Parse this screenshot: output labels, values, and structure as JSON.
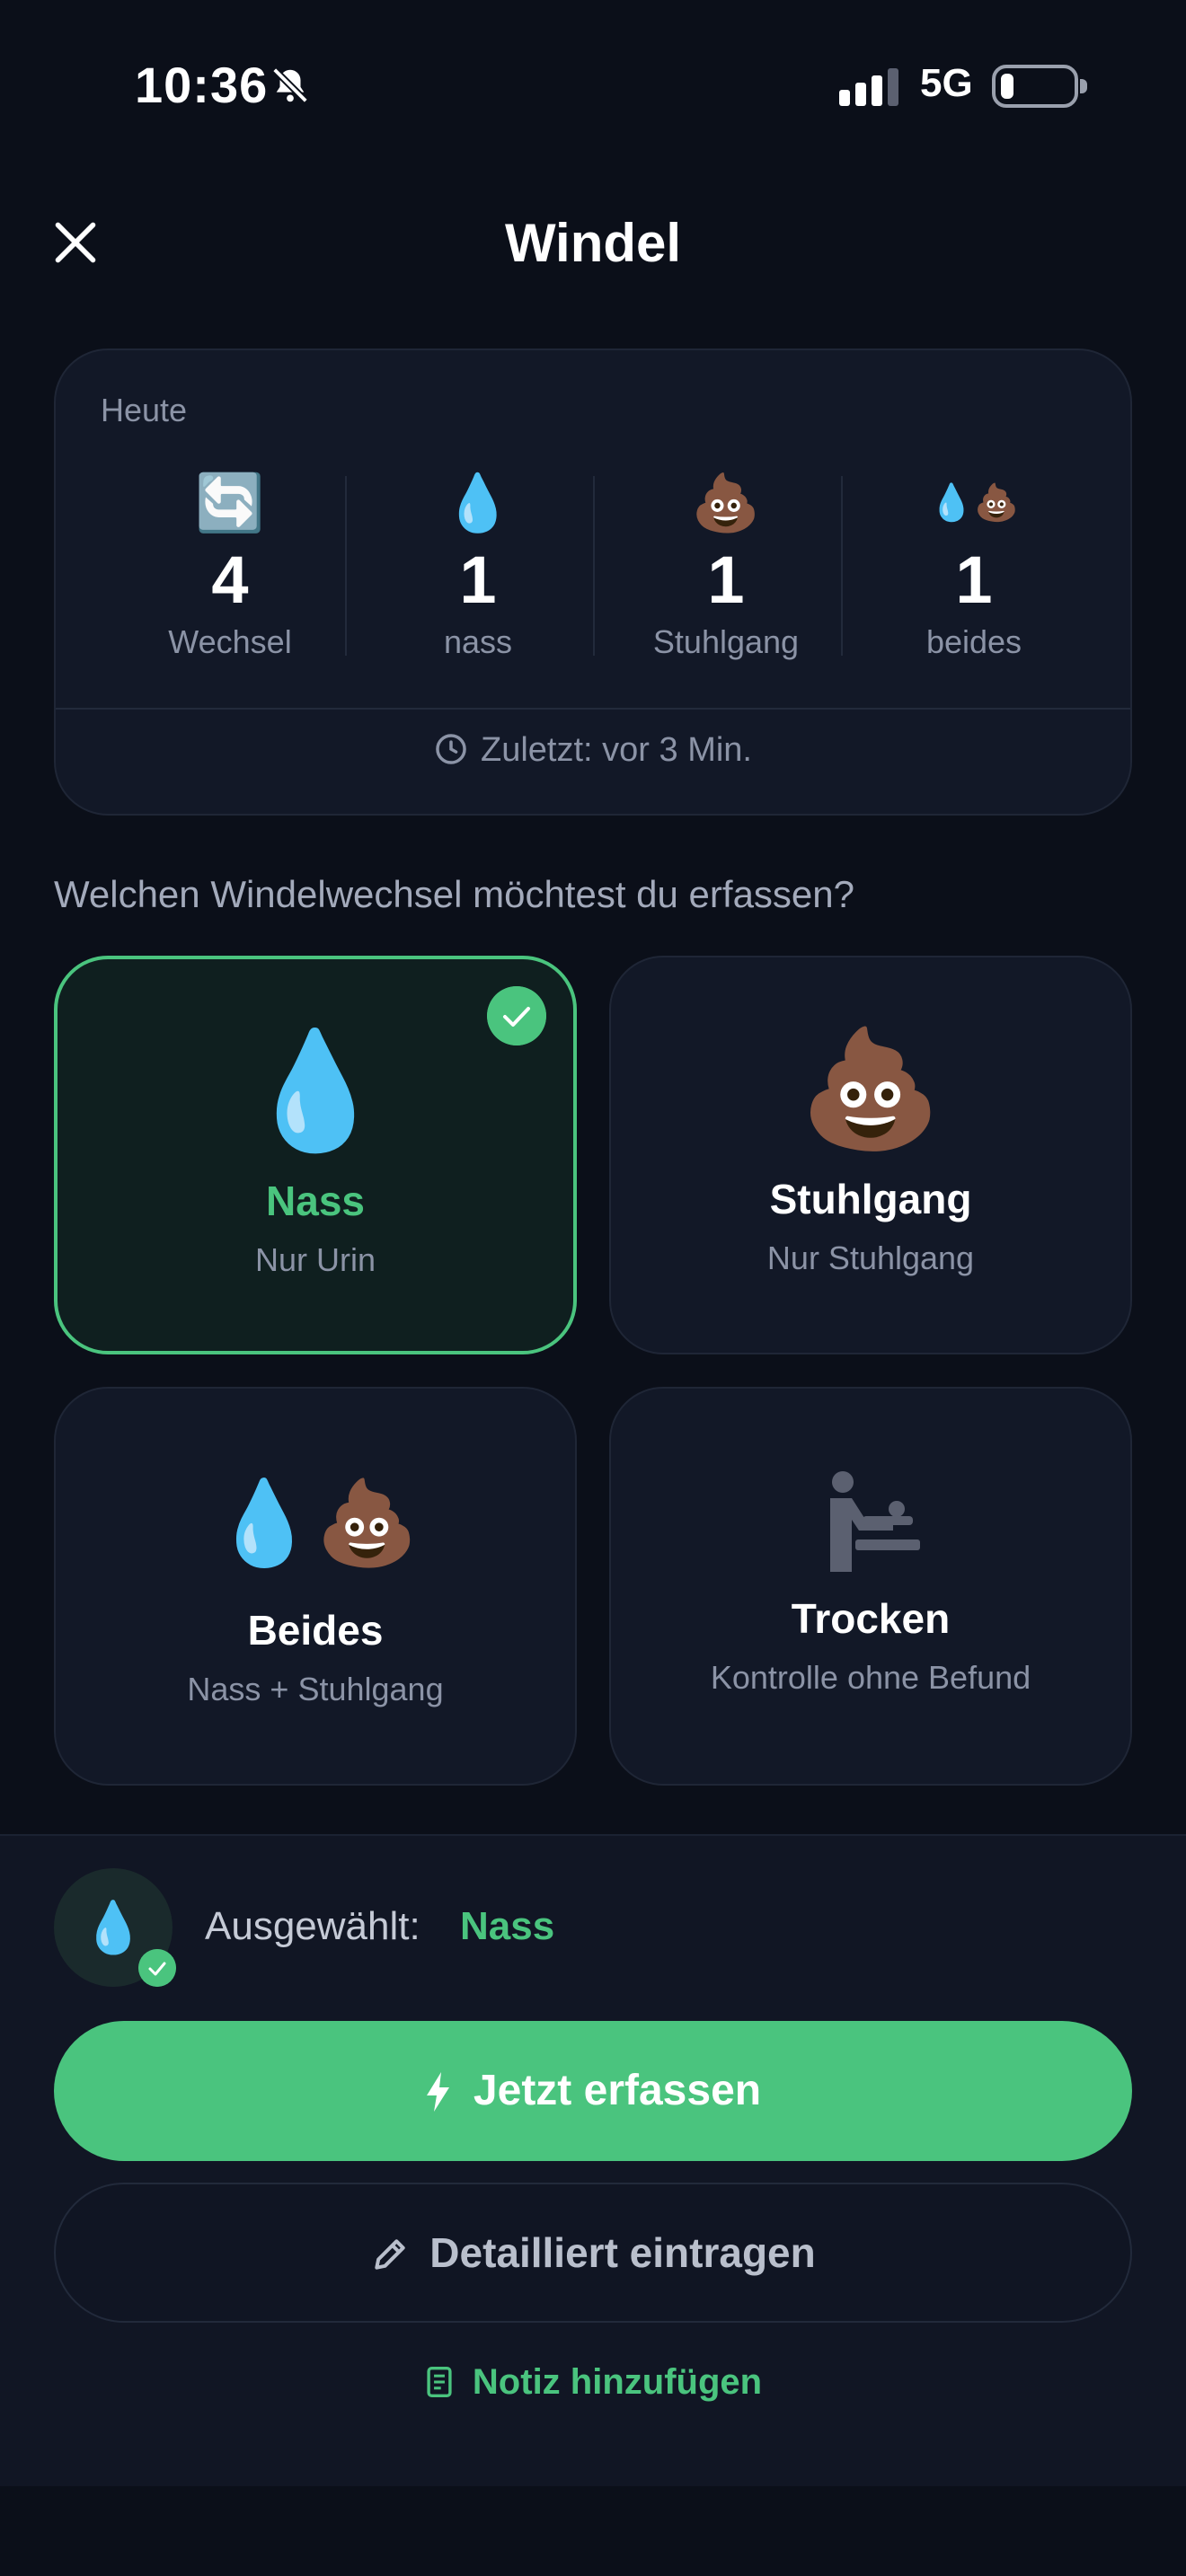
{
  "status_bar": {
    "time": "10:36",
    "network": "5G",
    "battery_level": 0.15
  },
  "header": {
    "title": "Windel"
  },
  "summary": {
    "heading": "Heute",
    "stats": [
      {
        "icon": "🔄",
        "value": "4",
        "label": "Wechsel"
      },
      {
        "icon": "💧",
        "value": "1",
        "label": "nass"
      },
      {
        "icon": "💩",
        "value": "1",
        "label": "Stuhlgang"
      },
      {
        "icon": "💧💩",
        "value": "1",
        "label": "beides"
      }
    ],
    "last": "Zuletzt: vor 3 Min."
  },
  "question": "Welchen Windelwechsel möchtest du erfassen?",
  "options": [
    {
      "icon": "💧",
      "name": "Nass",
      "sub": "Nur Urin",
      "selected": true
    },
    {
      "icon": "💩",
      "name": "Stuhlgang",
      "sub": "Nur Stuhlgang",
      "selected": false
    },
    {
      "icon": "💧💩",
      "name": "Beides",
      "sub": "Nass + Stuhlgang",
      "selected": false
    },
    {
      "icon": "baby-changing-icon",
      "name": "Trocken",
      "sub": "Kontrolle ohne Befund",
      "selected": false
    }
  ],
  "selection": {
    "label": "Ausgewählt:",
    "value": "Nass",
    "icon": "💧"
  },
  "actions": {
    "primary": "Jetzt erfassen",
    "secondary": "Detailliert eintragen",
    "note": "Notiz hinzufügen"
  },
  "colors": {
    "accent": "#4ac47e",
    "background": "#0b0f19",
    "card": "#121827"
  }
}
